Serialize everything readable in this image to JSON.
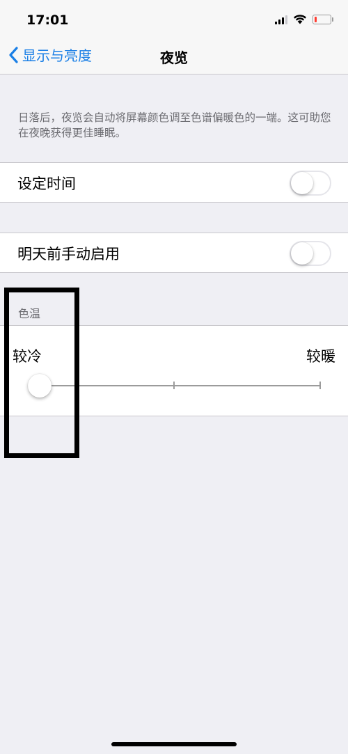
{
  "status_bar": {
    "time": "17:01",
    "icons": [
      "cellular-signal-icon",
      "wifi-icon",
      "battery-low-icon"
    ],
    "battery_color": "#ff3b30"
  },
  "nav": {
    "back_label": "显示与亮度",
    "title": "夜览",
    "accent_color": "#1a7fe6"
  },
  "description": "日落后，夜览会自动将屏幕颜色调至色谱偏暖色的一端。这可助您在夜晚获得更佳睡眠。",
  "rows": [
    {
      "label": "设定时间",
      "toggle_on": false
    },
    {
      "label": "明天前手动启用",
      "toggle_on": false
    }
  ],
  "color_temperature": {
    "header": "色温",
    "min_label": "较冷",
    "max_label": "较暖",
    "value": 0,
    "tick_stops": [
      0.5,
      1.0
    ]
  },
  "annotation": {
    "color": "#000000"
  }
}
